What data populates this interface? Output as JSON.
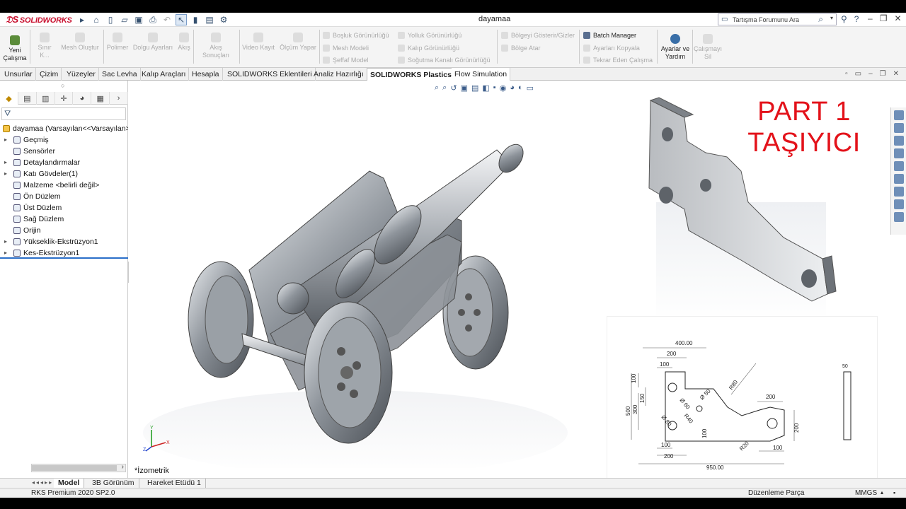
{
  "app": {
    "brand": "SOLIDWORKS",
    "document_title": "dayamaa"
  },
  "search": {
    "placeholder": "Tartışma Forumunu Ara"
  },
  "ribbon": {
    "new_study": "Yeni\nÇalışma",
    "boundary": "Sınır K...",
    "mesh_create": "Mesh Oluştur",
    "polymer": "Polimer",
    "fill_settings": "Dolgu Ayarları",
    "flow": "Akış",
    "flow_results": "Akış Sonuçları",
    "video_record": "Video Kayıt",
    "measure": "Ölçüm Yapar",
    "void_view": "Boşluk Görünürlüğü",
    "mesh_model": "Mesh Modeli",
    "transparent_model": "Şeffaf Model",
    "path_view": "Yolluk Görünürlüğü",
    "mold_view": "Kalıp Görünürlüğü",
    "cooling_view": "Soğutma Kanalı Görünürlüğü",
    "show_hide_regions": "Bölgeyi Gösterir/Gizler",
    "assign_region": "Bölge Atar",
    "batch_manager": "Batch Manager",
    "copy_settings": "Ayarları Kopyala",
    "repeat_study": "Tekrar Eden Çalışma",
    "settings_help": "Ayarlar ve\nYardım",
    "delete_study": "Çalışmayı\nSil"
  },
  "tabs": [
    {
      "label": "Unsurlar"
    },
    {
      "label": "Çizim"
    },
    {
      "label": "Yüzeyler"
    },
    {
      "label": "Sac Levha"
    },
    {
      "label": "Kalıp Araçları"
    },
    {
      "label": "Hesapla"
    },
    {
      "label": "SOLIDWORKS Eklentileri"
    },
    {
      "label": "Analiz Hazırlığı"
    },
    {
      "label": "SOLIDWORKS Plastics"
    },
    {
      "label": "Flow Simulation"
    }
  ],
  "tree": {
    "root": "dayamaa  (Varsayılan<<Varsayılan>_",
    "items": [
      {
        "label": "Geçmiş",
        "expand": "▸"
      },
      {
        "label": "Sensörler",
        "expand": ""
      },
      {
        "label": "Detaylandırmalar",
        "expand": "▸"
      },
      {
        "label": "Katı Gövdeler(1)",
        "expand": "▸"
      },
      {
        "label": "Malzeme <belirli değil>",
        "expand": ""
      },
      {
        "label": "Ön Düzlem",
        "expand": ""
      },
      {
        "label": "Üst Düzlem",
        "expand": ""
      },
      {
        "label": "Sağ Düzlem",
        "expand": ""
      },
      {
        "label": "Orijin",
        "expand": ""
      },
      {
        "label": "Yükseklik-Ekstrüzyon1",
        "expand": "▸"
      },
      {
        "label": "Kes-Ekstrüzyon1",
        "expand": "▸"
      }
    ]
  },
  "viewport": {
    "part_title_1": "PART 1",
    "part_title_2": "TAŞIYICI",
    "view_label": "*İzometrik",
    "triad_y": "Y",
    "triad_x": "X",
    "triad_z": "Z"
  },
  "drawing": {
    "dim_400": "400.00",
    "dim_200_top": "200",
    "dim_100_top": "100",
    "dim_100_left": "100",
    "dim_150": "150",
    "dim_300": "300",
    "dim_500": "500",
    "dim_d60": "Ø 60",
    "dim_d50": "Ø 50",
    "dim_r80": "R80",
    "dim_200_right": "200",
    "dim_200_vert": "200",
    "dim_d80": "Ø 80",
    "dim_r40": "R40",
    "dim_100_mid": "100",
    "dim_r20": "R20",
    "dim_100_br": "100",
    "dim_100_bl": "100",
    "dim_200_bl": "200",
    "dim_950": "950.00",
    "dim_50": "50"
  },
  "bottom_tabs": [
    {
      "label": "Model"
    },
    {
      "label": "3B Görünüm"
    },
    {
      "label": "Hareket Etüdü 1"
    }
  ],
  "status": {
    "product": "RKS Premium 2020 SP2.0",
    "mode": "Düzenleme Parça",
    "units": "MMGS"
  },
  "colors": {
    "brand_red": "#c8102e",
    "title_red": "#e3121a",
    "tree_selection": "#2a6fc9"
  }
}
